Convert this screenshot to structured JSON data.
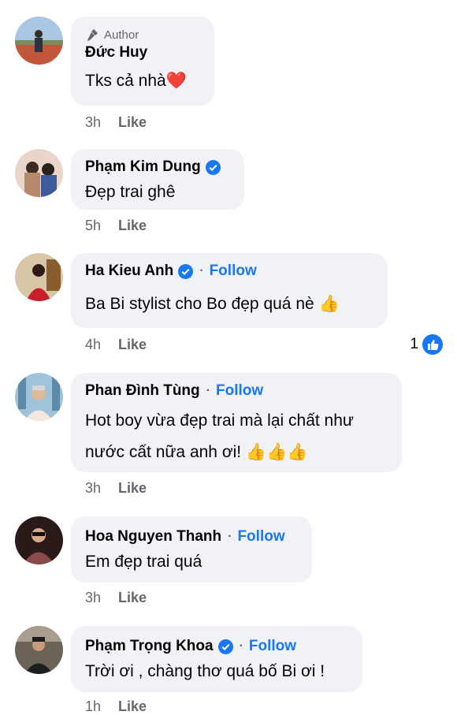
{
  "comments": [
    {
      "author_badge": "Author",
      "name": "Đức Huy",
      "verified": false,
      "follow": "",
      "lines": [
        "Tks cả nhà❤️"
      ],
      "time": "3h",
      "like": "Like"
    },
    {
      "name": "Phạm Kim Dung",
      "verified": true,
      "follow": "",
      "lines": [
        "Đẹp trai ghê"
      ],
      "time": "5h",
      "like": "Like"
    },
    {
      "name": "Ha Kieu Anh",
      "verified": true,
      "follow": "Follow",
      "lines": [
        "Ba Bi stylist cho Bo đẹp quá nè 👍"
      ],
      "time": "4h",
      "like": "Like",
      "reaction_count": "1"
    },
    {
      "name": "Phan Đình Tùng",
      "verified": false,
      "follow": "Follow",
      "lines": [
        "Hot boy vừa đẹp trai mà lại chất như",
        "nước cất nữa anh ơi! 👍👍👍"
      ],
      "time": "3h",
      "like": "Like"
    },
    {
      "name": "Hoa Nguyen Thanh",
      "verified": false,
      "follow": "Follow",
      "lines": [
        "Em đẹp trai quá"
      ],
      "time": "3h",
      "like": "Like"
    },
    {
      "name": "Phạm Trọng Khoa",
      "verified": true,
      "follow": "Follow",
      "lines": [
        "Trời ơi , chàng thơ quá bố Bi ơi !"
      ],
      "time": "1h",
      "like": "Like"
    }
  ],
  "colors": {
    "link": "#1877f2",
    "bubble": "#f0f2f5",
    "meta": "#65676b"
  }
}
